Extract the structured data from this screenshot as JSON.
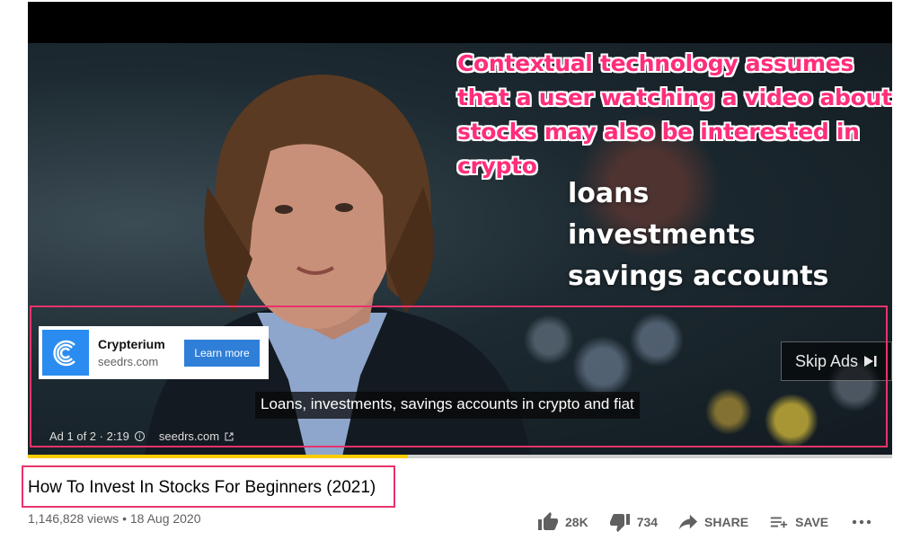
{
  "player": {
    "callout_lines": [
      "Contextual technology assumes",
      "that a user watching a video about",
      "stocks may also be interested in",
      "crypto"
    ],
    "overlay_lines": [
      "loans",
      "investments",
      "savings accounts"
    ],
    "ad": {
      "title": "Crypterium",
      "domain": "seedrs.com",
      "cta": "Learn more"
    },
    "skip_label": "Skip Ads",
    "caption": "Loans, investments, savings accounts in crypto and fiat",
    "ad_counter": "Ad 1 of 2 · 2:19",
    "ad_link": "seedrs.com",
    "progress": 0.44
  },
  "video": {
    "title": "How To Invest In Stocks For Beginners (2021)",
    "views": "1,146,828 views",
    "date": "18 Aug 2020",
    "likes": "28K",
    "dislikes": "734",
    "share_label": "SHARE",
    "save_label": "SAVE"
  },
  "colors": {
    "highlight": "#e8336b",
    "callout": "#ff2d7a",
    "progress": "#ffcc00",
    "cta": "#2f7fd8"
  }
}
